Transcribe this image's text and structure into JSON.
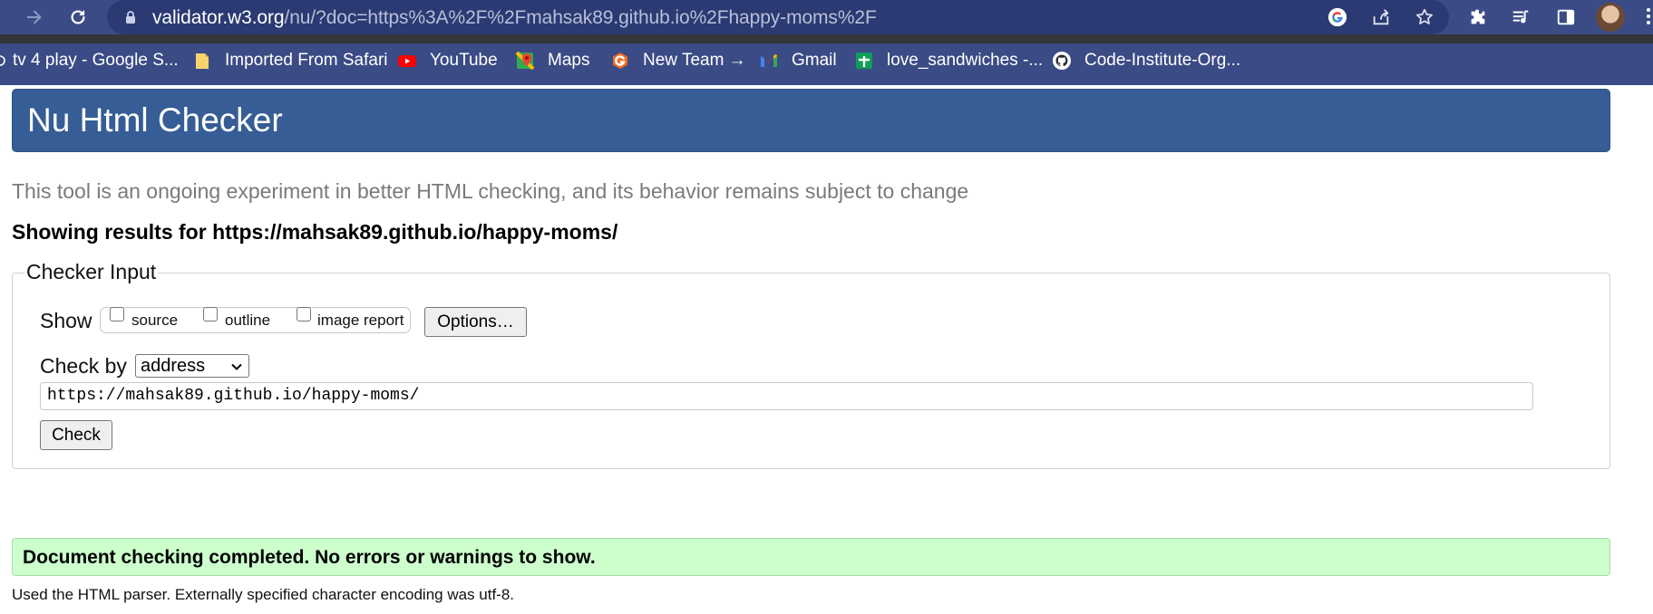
{
  "browser": {
    "url_host": "validator.w3.org",
    "url_rest": "/nu/?doc=https%3A%2F%2Fmahsak89.github.io%2Fhappy-moms%2F",
    "bookmarks": [
      {
        "label": "tv 4 play - Google S...",
        "icon": "globe-icon"
      },
      {
        "label": "Imported From Safari",
        "icon": "folder-icon"
      },
      {
        "label": "YouTube",
        "icon": "youtube-icon"
      },
      {
        "label": "Maps",
        "icon": "maps-icon"
      },
      {
        "label": "New Team →",
        "icon": "orange-g-icon"
      },
      {
        "label": "Gmail",
        "icon": "gmail-icon"
      },
      {
        "label": "love_sandwiches -...",
        "icon": "sheets-icon"
      },
      {
        "label": "Code-Institute-Org...",
        "icon": "github-icon"
      }
    ]
  },
  "page": {
    "title": "Nu Html Checker",
    "intro": "This tool is an ongoing experiment in better HTML checking, and its behavior remains subject to change",
    "results_for": "Showing results for https://mahsak89.github.io/happy-moms/",
    "checker": {
      "legend": "Checker Input",
      "show_label": "Show",
      "show_options": [
        "source",
        "outline",
        "image report"
      ],
      "options_button": "Options…",
      "check_by_label": "Check by",
      "check_by_value": "address",
      "address_value": "https://mahsak89.github.io/happy-moms/",
      "check_button": "Check"
    },
    "success_message": "Document checking completed. No errors or warnings to show.",
    "footer_note": "Used the HTML parser. Externally specified character encoding was utf-8."
  },
  "colors": {
    "chrome": "#3b4b85",
    "banner": "#365d95",
    "success_bg": "#ccffcc"
  }
}
